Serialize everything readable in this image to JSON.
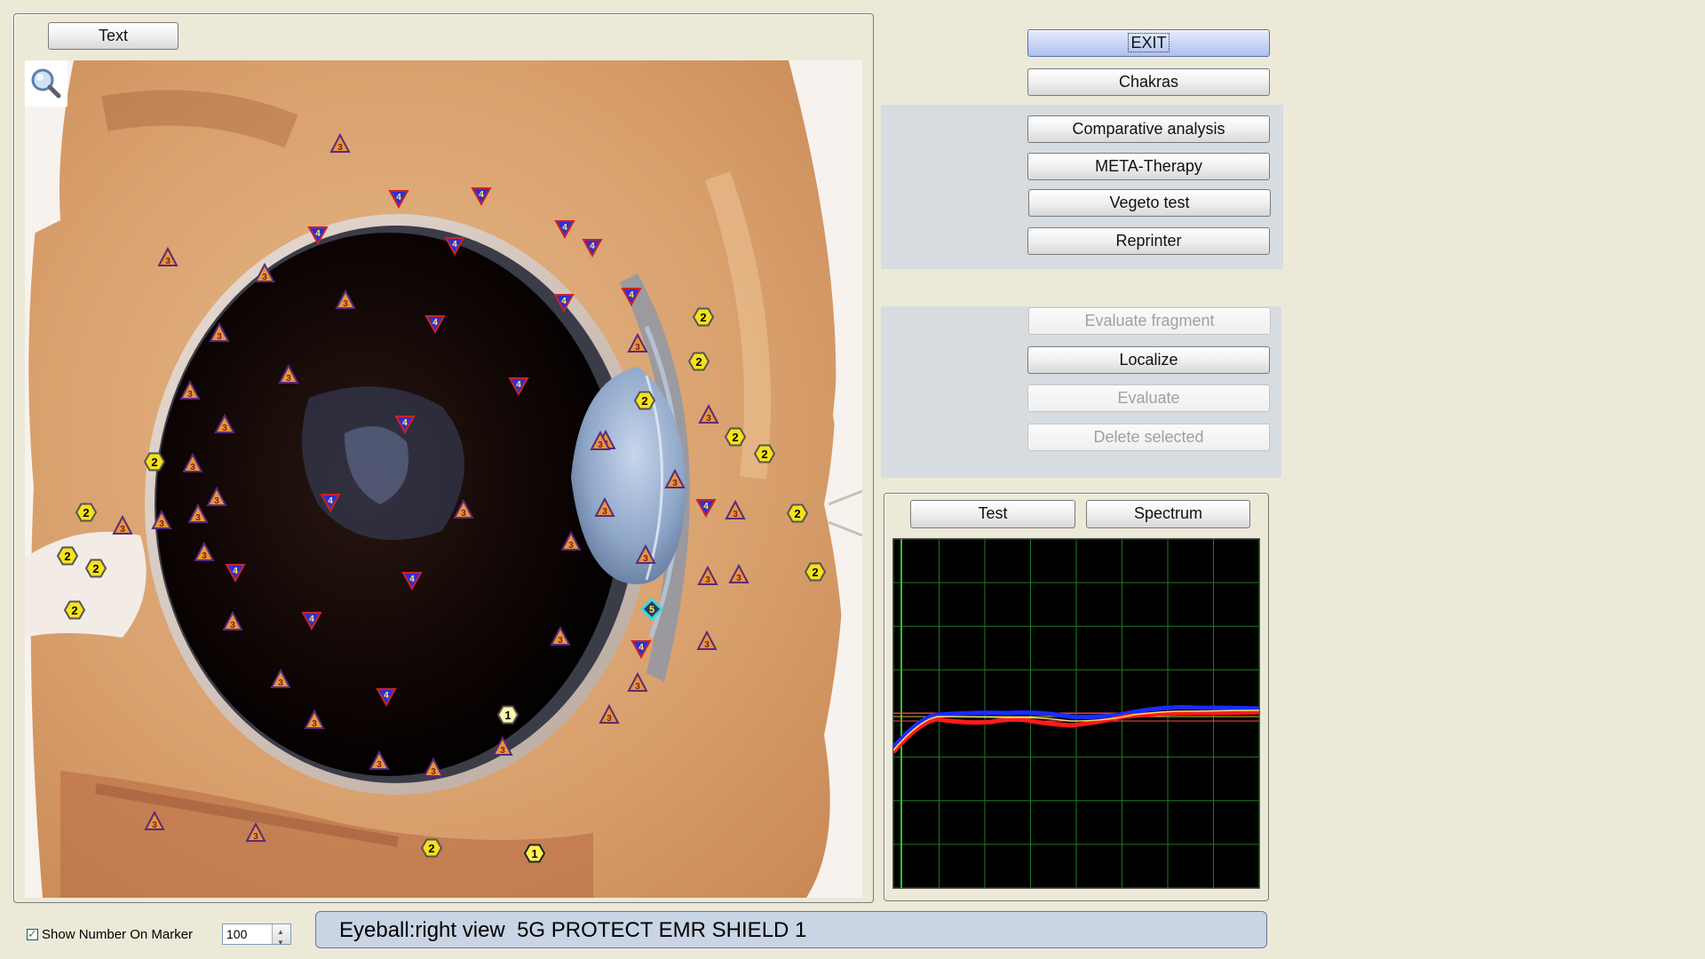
{
  "image_panel": {
    "text_button_label": "Text",
    "zoom_icon": "magnifier-icon"
  },
  "right_panel": {
    "exit_label": "EXIT",
    "chakras_label": "Chakras",
    "comparative_label": "Comparative analysis",
    "meta_therapy_label": "META-Therapy",
    "vegeto_label": "Vegeto test",
    "reprinter_label": "Reprinter",
    "evaluate_fragment_label": "Evaluate fragment",
    "localize_label": "Localize",
    "evaluate_label": "Evaluate",
    "delete_selected_label": "Delete selected"
  },
  "graph_panel": {
    "test_label": "Test",
    "spectrum_label": "Spectrum"
  },
  "bottom": {
    "show_number_label": "Show Number On Marker",
    "show_number_checked": true,
    "zoom_value": "100",
    "status_text": "Eyeball:right view  5G PROTECT EMR SHIELD 1"
  },
  "colors": {
    "background": "#ece9d8",
    "status_bar": "#c9d4e4",
    "graph_bg": "#000000",
    "graph_grid": "#1f7a1f",
    "series_blue": "#1a2cff",
    "series_red": "#ff1a1a",
    "marker_yellow": "#f5e21a",
    "marker_triangle": "#e6953a",
    "marker_down_triangle": "#2f2fd6"
  },
  "markers": {
    "hex2": [
      "2",
      "2",
      "2",
      "2",
      "2",
      "2",
      "2",
      "2",
      "2",
      "2",
      "2",
      "2",
      "2",
      "2"
    ],
    "tri3_label": "3",
    "tri4_label": "4",
    "hex1_label": "1",
    "diamond5_label": "5"
  }
}
